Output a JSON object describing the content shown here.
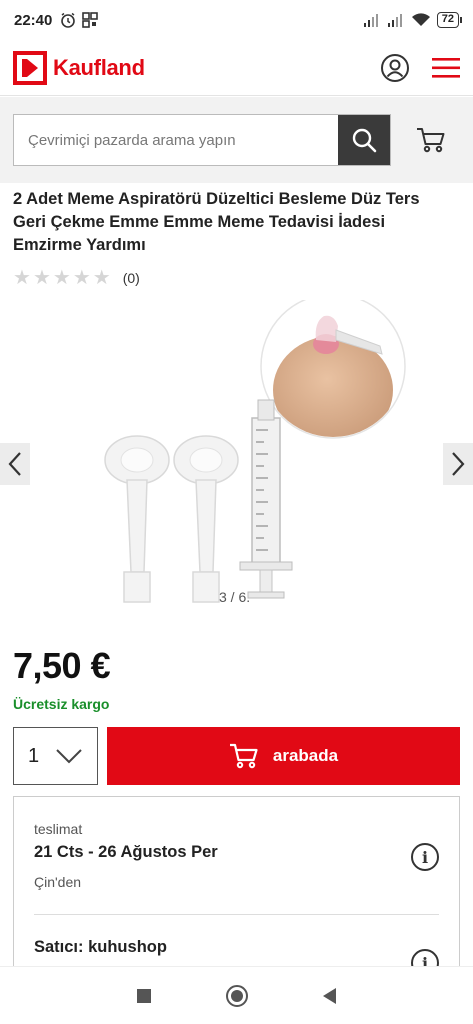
{
  "status_bar": {
    "time": "22:40",
    "battery": "72"
  },
  "brand": {
    "name": "Kaufland",
    "color": "#e10915"
  },
  "search": {
    "placeholder": "Çevrimiçi pazarda arama yapın"
  },
  "product": {
    "title": "2 Adet Meme Aspiratörü Düzeltici Besleme Düz Ters Geri Çekme Emme Emme Meme Tedavisi İadesi Emzirme Yardımı",
    "rating_stars": 0,
    "rating_count": "(0)",
    "image_counter": "3 / 6.",
    "price": "7,50 €",
    "shipping": "Ücretsiz kargo",
    "quantity": "1",
    "add_to_cart_label": "arabada"
  },
  "delivery": {
    "label": "teslimat",
    "date": "21 Cts - 26 Ağustos Per",
    "origin": "Çin'den",
    "seller": "Satıcı: kuhushop"
  },
  "icons": [
    "clock-icon",
    "grid-icon",
    "signal-icon",
    "wifi-icon",
    "battery-icon",
    "account-icon",
    "menu-icon",
    "search-icon",
    "cart-icon",
    "star-icon",
    "chevron-left-icon",
    "chevron-right-icon",
    "chevron-down-icon",
    "info-icon"
  ]
}
